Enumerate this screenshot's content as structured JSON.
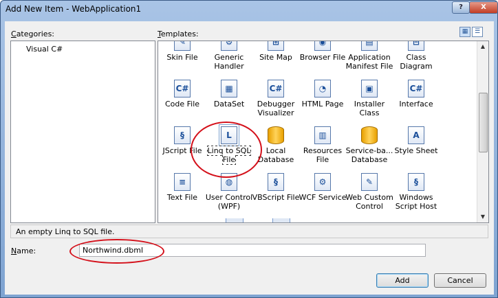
{
  "window": {
    "title": "Add New Item - WebApplication1",
    "help_label": "?",
    "close_label": "X"
  },
  "categories": {
    "label_underlined": "C",
    "label_rest": "ategories:",
    "items": [
      "Visual C#"
    ]
  },
  "templates": {
    "label_underlined": "T",
    "label_rest": "emplates:",
    "view_large_label": "▦",
    "view_small_label": "☰",
    "items": [
      {
        "label": "Skin File",
        "icon": "skin-file-icon",
        "glyph": "✎"
      },
      {
        "label": "Generic Handler",
        "icon": "generic-handler-icon",
        "glyph": "⚙"
      },
      {
        "label": "Site Map",
        "icon": "site-map-icon",
        "glyph": "⊞"
      },
      {
        "label": "Browser File",
        "icon": "browser-file-icon",
        "glyph": "◉"
      },
      {
        "label": "Application Manifest File",
        "icon": "manifest-file-icon",
        "glyph": "▤"
      },
      {
        "label": "Class Diagram",
        "icon": "class-diagram-icon",
        "glyph": "⊟"
      },
      {
        "label": "Code File",
        "icon": "code-file-icon",
        "glyph": "C#"
      },
      {
        "label": "DataSet",
        "icon": "dataset-icon",
        "glyph": "▦"
      },
      {
        "label": "Debugger Visualizer",
        "icon": "debugger-visualizer-icon",
        "glyph": "C#"
      },
      {
        "label": "HTML Page",
        "icon": "html-page-icon",
        "glyph": "◔"
      },
      {
        "label": "Installer Class",
        "icon": "installer-class-icon",
        "glyph": "▣"
      },
      {
        "label": "Interface",
        "icon": "interface-icon",
        "glyph": "C#"
      },
      {
        "label": "JScript File",
        "icon": "jscript-file-icon",
        "glyph": "§"
      },
      {
        "label": "Linq to SQL File",
        "icon": "linq-to-sql-icon",
        "glyph": "L"
      },
      {
        "label": "Local Database",
        "icon": "local-database-icon",
        "glyph": ""
      },
      {
        "label": "Resources File",
        "icon": "resources-file-icon",
        "glyph": "▥"
      },
      {
        "label": "Service-ba... Database",
        "icon": "service-database-icon",
        "glyph": ""
      },
      {
        "label": "Style Sheet",
        "icon": "style-sheet-icon",
        "glyph": "A"
      },
      {
        "label": "Text File",
        "icon": "text-file-icon",
        "glyph": "≡"
      },
      {
        "label": "User Control (WPF)",
        "icon": "user-control-icon",
        "glyph": "◍"
      },
      {
        "label": "VBScript File",
        "icon": "vbscript-file-icon",
        "glyph": "§"
      },
      {
        "label": "WCF Service",
        "icon": "wcf-service-icon",
        "glyph": "⚙"
      },
      {
        "label": "Web Custom Control",
        "icon": "web-custom-control-icon",
        "glyph": "✎"
      },
      {
        "label": "Windows Script Host",
        "icon": "windows-script-host-icon",
        "glyph": "§"
      }
    ],
    "selected_index": 13
  },
  "description": "An empty Linq to SQL file.",
  "name": {
    "label_underlined": "N",
    "label_rest": "ame:",
    "value": "Northwind.dbml"
  },
  "buttons": {
    "add": "Add",
    "cancel": "Cancel"
  },
  "colors": {
    "annotation_ring": "#d4101a",
    "selection": "#3399ff"
  }
}
